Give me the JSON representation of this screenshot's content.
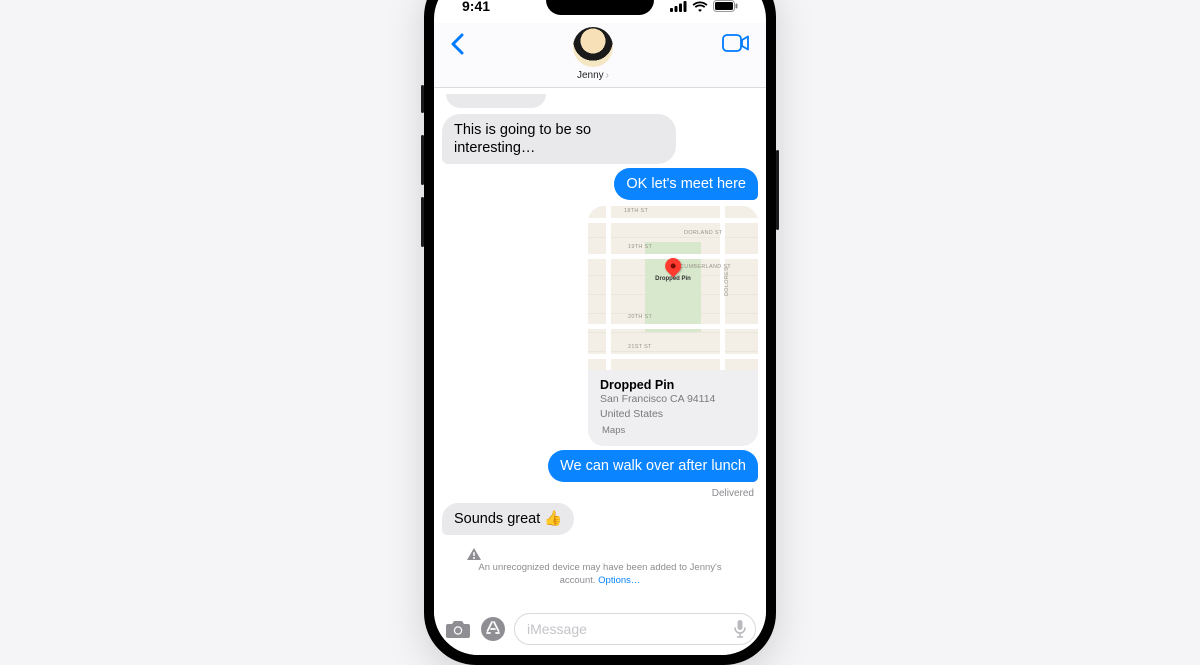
{
  "status": {
    "time": "9:41"
  },
  "header": {
    "contact_name": "Jenny"
  },
  "messages": {
    "in1": "This is going to be so interesting…",
    "out1": "OK let's meet here",
    "out2": "We can walk over after lunch",
    "in2": "Sounds great 👍",
    "delivered": "Delivered"
  },
  "map": {
    "title": "Dropped Pin",
    "address_line1": "San Francisco CA 94114",
    "address_line2": "United States",
    "source": "Maps",
    "pin_label": "Dropped Pin",
    "streets": {
      "s18": "18TH ST",
      "s19": "19TH ST",
      "s20": "20TH ST",
      "s21": "21ST ST",
      "dorland": "DORLAND ST",
      "cumberland": "CUMBERLAND ST",
      "dolores": "DOLORES"
    }
  },
  "warning": {
    "text_prefix": "An unrecognized device may have been added to Jenny's account. ",
    "link": "Options…"
  },
  "compose": {
    "placeholder": "iMessage"
  }
}
